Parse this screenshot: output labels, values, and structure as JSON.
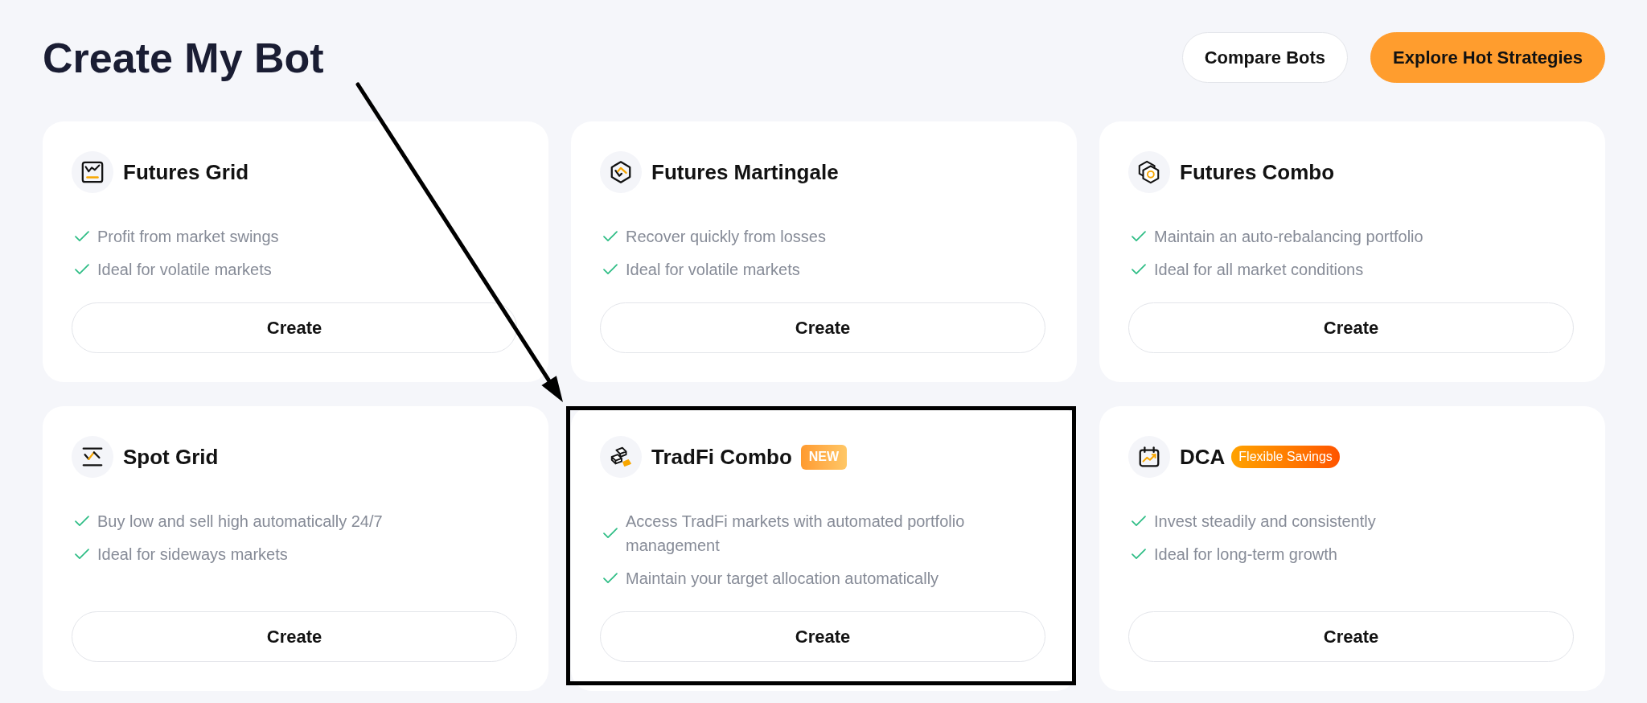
{
  "page": {
    "title": "Create My Bot"
  },
  "header_buttons": [
    {
      "label": "Compare Bots",
      "kind": "secondary"
    },
    {
      "label": "Explore Hot Strategies",
      "kind": "primary"
    }
  ],
  "bots": [
    {
      "name": "Futures Grid",
      "features": [
        "Profit from market swings",
        "Ideal for volatile markets"
      ],
      "button": "Create",
      "highlighted": false
    },
    {
      "name": "Futures Martingale",
      "features": [
        "Recover quickly from losses",
        "Ideal for volatile markets"
      ],
      "button": "Create",
      "highlighted": false
    },
    {
      "name": "Futures Combo",
      "features": [
        "Maintain an auto-rebalancing portfolio",
        "Ideal for all market conditions"
      ],
      "button": "Create",
      "highlighted": false
    },
    {
      "name": "Spot Grid",
      "features": [
        "Buy low and sell high automatically 24/7",
        "Ideal for sideways markets"
      ],
      "button": "Create",
      "highlighted": false
    },
    {
      "name": "TradFi Combo",
      "badge": {
        "text": "NEW",
        "kind": "new"
      },
      "features": [
        "Access TradFi markets with automated portfolio management",
        "Maintain your target allocation automatically"
      ],
      "button": "Create",
      "highlighted": true
    },
    {
      "name": "DCA",
      "badge": {
        "text": "Flexible Savings",
        "kind": "promo"
      },
      "features": [
        "Invest steadily and consistently",
        "Ideal for long-term growth"
      ],
      "button": "Create",
      "highlighted": false
    }
  ]
}
